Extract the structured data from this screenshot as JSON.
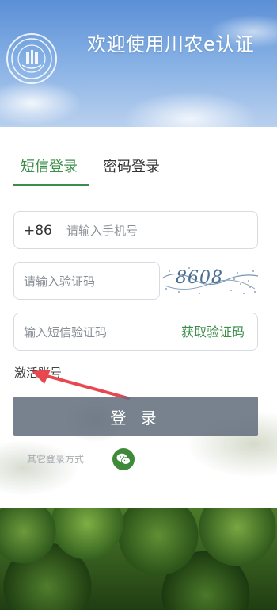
{
  "header": {
    "title": "欢迎使用川农e认证",
    "logo_icon": "university-seal-icon"
  },
  "tabs": [
    {
      "label": "短信登录",
      "active": true
    },
    {
      "label": "密码登录",
      "active": false
    }
  ],
  "form": {
    "phone_prefix": "+86",
    "phone_placeholder": "请输入手机号",
    "captcha_placeholder": "请输入验证码",
    "captcha_image_text": "8608",
    "sms_placeholder": "输入短信验证码",
    "get_code_label": "获取验证码"
  },
  "activate_label": "激活账号",
  "login_label": "登 录",
  "other_login_label": "其它登录方式",
  "social": {
    "wechat_icon": "wechat-icon"
  },
  "colors": {
    "accent_green": "#3b8d48",
    "login_button": "#606c7a",
    "annotation_arrow": "#e8474f"
  }
}
